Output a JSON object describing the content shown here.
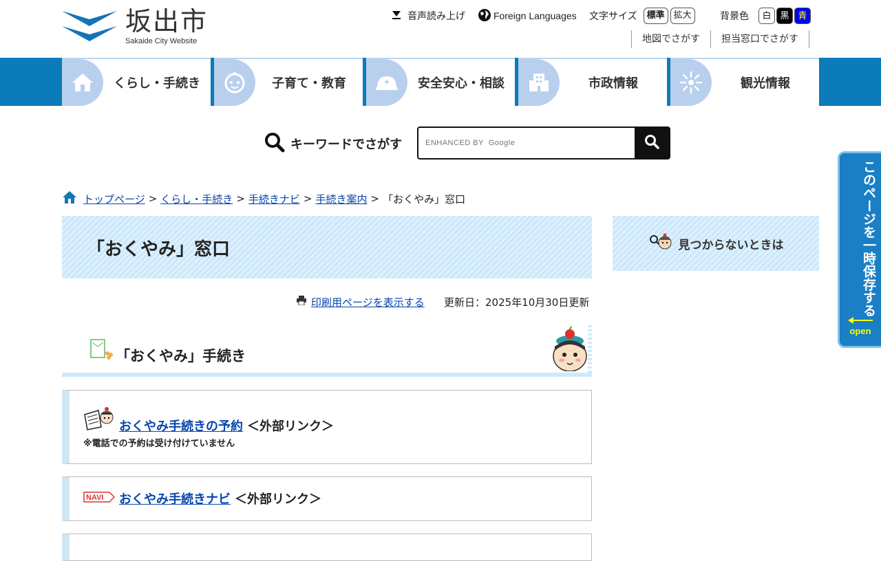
{
  "header": {
    "logo_ja": "坂出市",
    "logo_en": "Sakaide City Website",
    "voice": "音声読み上げ",
    "languages": "Foreign Languages",
    "font_size_label": "文字サイズ",
    "font_size_standard": "標準",
    "font_size_large": "拡大",
    "bg_label": "背景色",
    "bg_white": "白",
    "bg_black": "黒",
    "bg_blue": "青",
    "map_search": "地図でさがす",
    "office_search": "担当窓口でさがす"
  },
  "nav": {
    "items": [
      {
        "label": "くらし・手続き",
        "icon": "house-icon"
      },
      {
        "label": "子育て・教育",
        "icon": "baby-icon"
      },
      {
        "label": "安全安心・相談",
        "icon": "helmet-icon"
      },
      {
        "label": "市政情報",
        "icon": "building-icon"
      },
      {
        "label": "観光情報",
        "icon": "firework-icon"
      }
    ]
  },
  "search": {
    "label": "キーワードでさがす",
    "placeholder": "ENHANCED BY  Google"
  },
  "breadcrumb": {
    "items": [
      "トップページ",
      "くらし・手続き",
      "手続きナビ",
      "手続き案内"
    ],
    "current": "「おくやみ」窓口",
    "sep": ">"
  },
  "page": {
    "title": "「おくやみ」窓口",
    "print_link": "印刷用ページを表示する",
    "updated": "更新日：2025年10月30日更新",
    "side_box": "見つからないときは"
  },
  "section": {
    "heading": "「おくやみ」手続き"
  },
  "cards": [
    {
      "link": "おくやみ手続きの予約",
      "ext": "＜外部リンク＞",
      "note": "※電話での予約は受け付けていません"
    },
    {
      "link": "おくやみ手続きナビ",
      "ext": "＜外部リンク＞",
      "badge": "NAVI"
    }
  ],
  "save_tab": {
    "text": "このページを一時保存する",
    "open": "open"
  },
  "colors": {
    "nav_bg": "#0c7bb9",
    "nav_icon_bg": "#b8d0ee",
    "link": "#0645ad",
    "title_bg": "#cbe7fa",
    "save_tab": "#1a7fc4"
  }
}
